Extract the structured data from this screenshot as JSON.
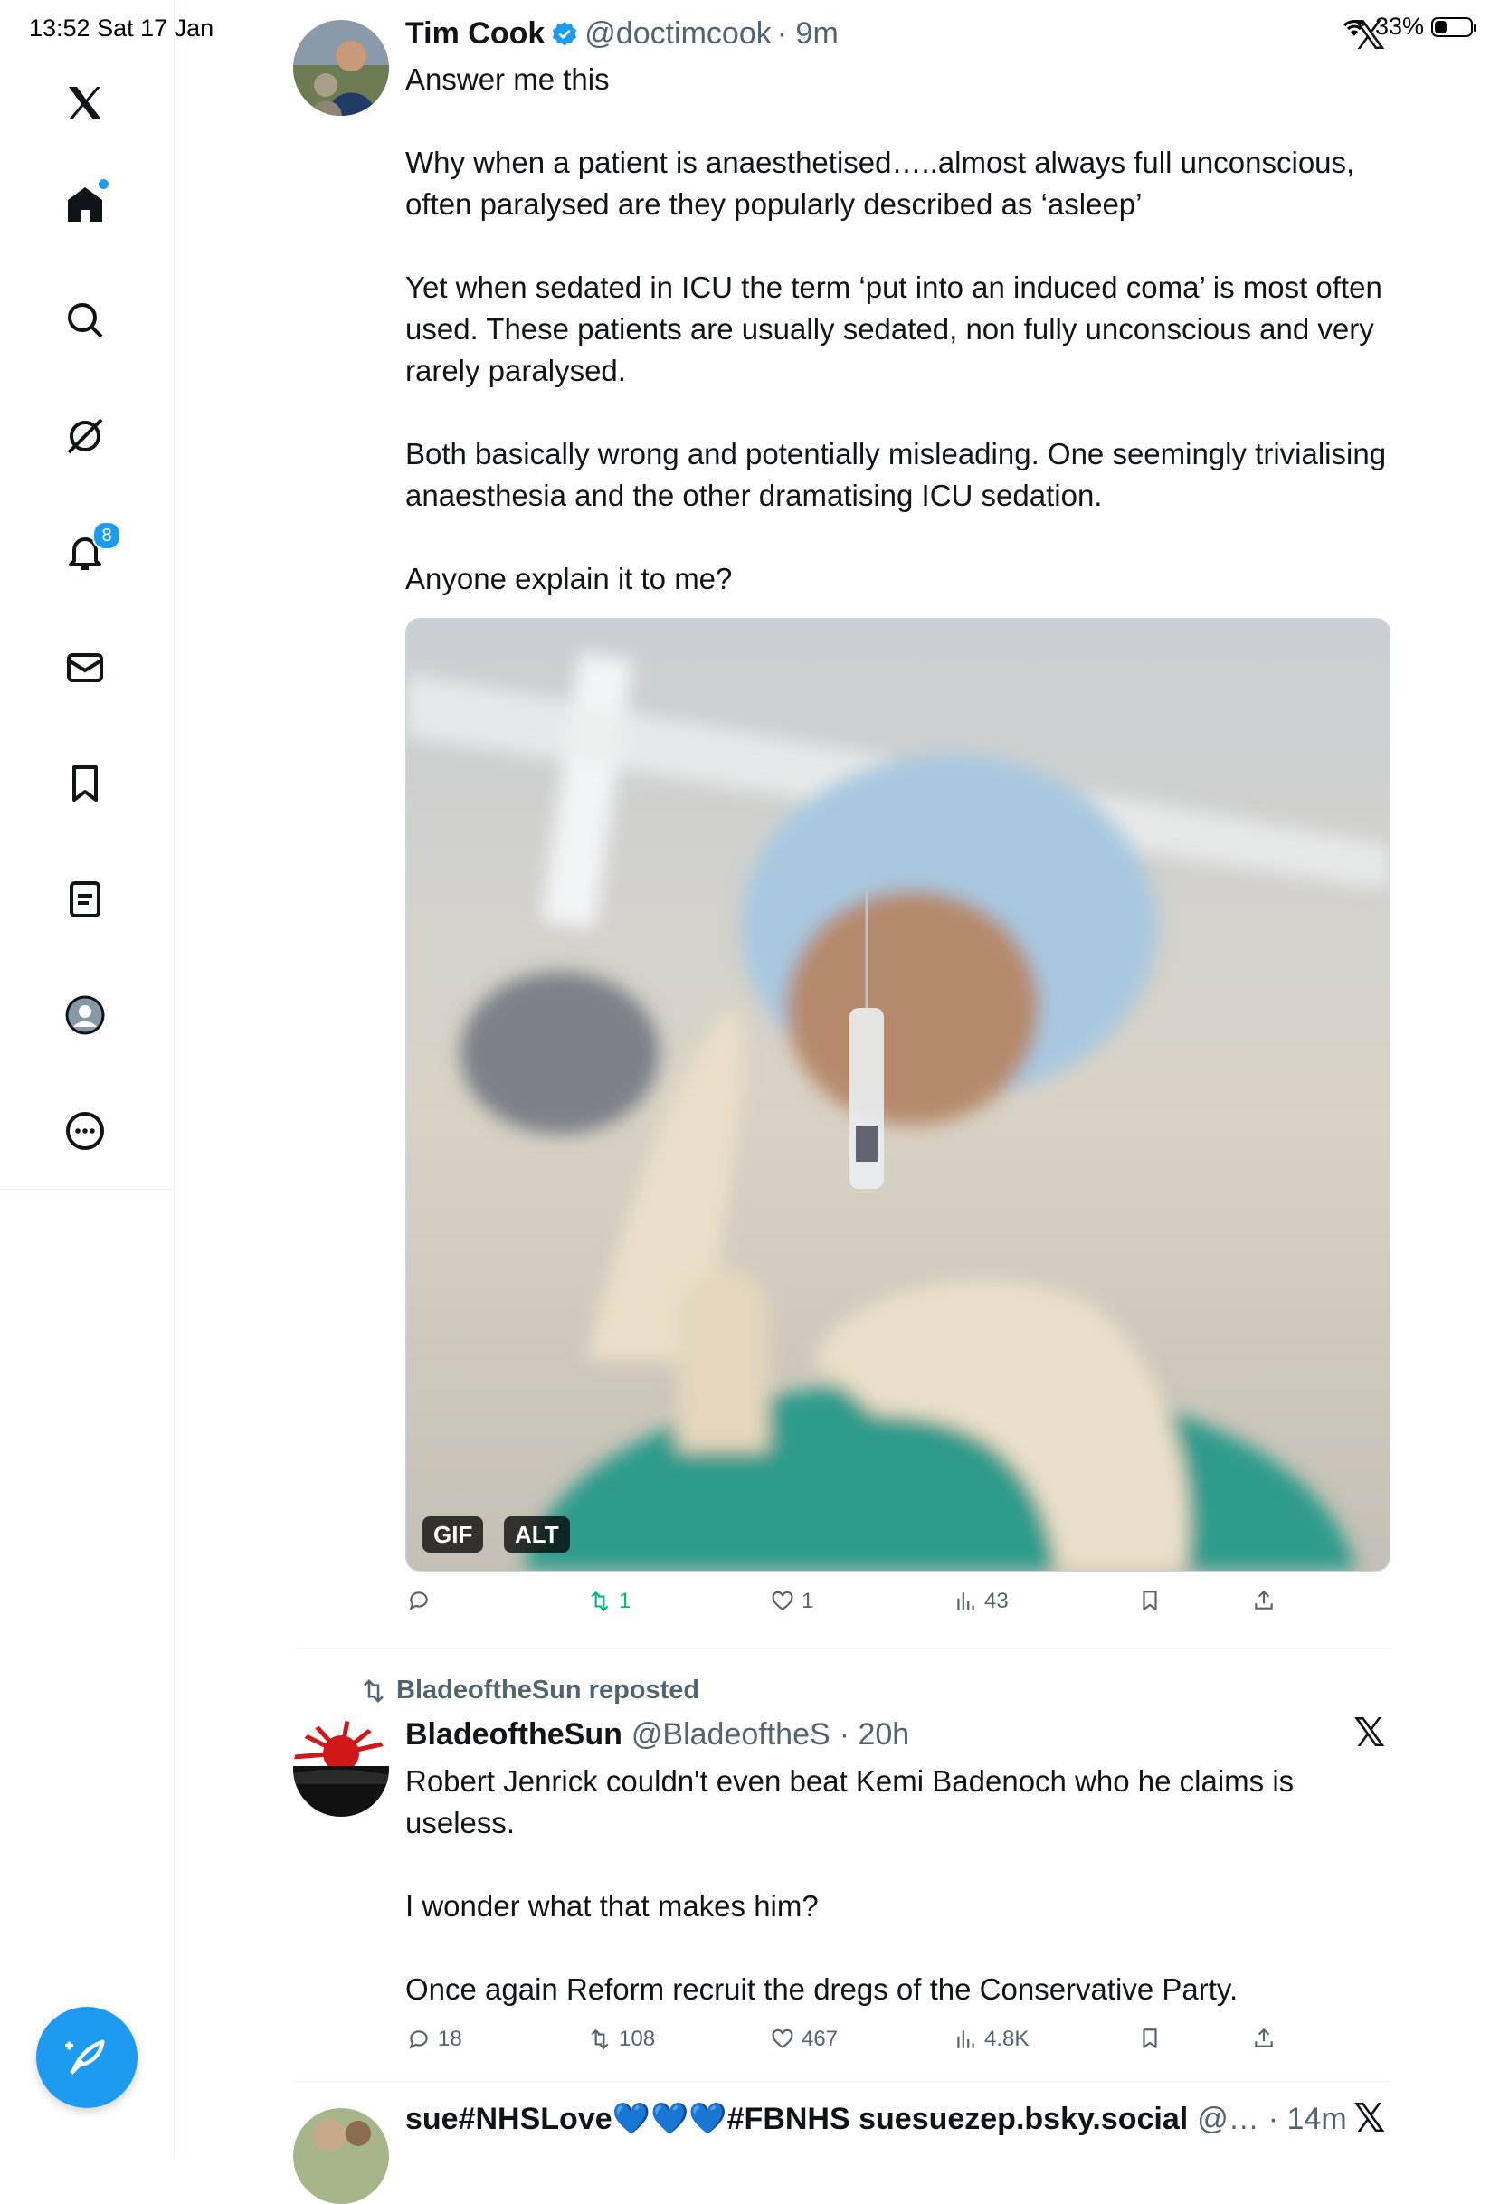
{
  "status_bar": {
    "time": "13:52  Sat 17 Jan",
    "battery": "33%",
    "battery_level": 0.33
  },
  "sidebar": {
    "items": [
      {
        "name": "x-logo"
      },
      {
        "name": "home"
      },
      {
        "name": "search"
      },
      {
        "name": "grok"
      },
      {
        "name": "notifications",
        "badge": "8"
      },
      {
        "name": "messages"
      },
      {
        "name": "bookmarks"
      },
      {
        "name": "lists"
      },
      {
        "name": "profile"
      },
      {
        "name": "more"
      }
    ]
  },
  "tweets": [
    {
      "name": "Tim Cook",
      "verified": true,
      "handle": "@doctimcook",
      "time": "· 9m",
      "text": "Answer me this\n\nWhy when a patient is anaesthetised…..almost always full unconscious, often paralysed are they popularly described as ‘asleep’\n\nYet when sedated in ICU the term ‘put into an induced coma’ is most often used. These patients are usually sedated, non fully unconscious and very rarely paralysed.\n\nBoth basically wrong and potentially misleading. One seemingly trivialising anaesthesia and the other dramatising ICU sedation.\n\nAnyone explain it to me?",
      "media_badges": [
        "GIF",
        "ALT"
      ],
      "actions": {
        "replies": "",
        "reposts": "1",
        "likes": "1",
        "views": "43"
      }
    },
    {
      "repost_label": "BladeoftheSun reposted",
      "name": "BladeoftheSun",
      "handle": "@BladeoftheS",
      "time": "· 20h",
      "text": "Robert Jenrick couldn't even beat Kemi Badenoch who he claims is useless.\n\nI wonder what that makes him?\n\nOnce again Reform recruit the dregs of the Conservative Party.",
      "actions": {
        "replies": "18",
        "reposts": "108",
        "likes": "467",
        "views": "4.8K"
      }
    },
    {
      "name": "sue#NHSLove💙💙💙#FBNHS suesuezep.bsky.social",
      "handle": "@…",
      "time": "· 14m"
    }
  ],
  "colors": {
    "accent": "#1d9bf0",
    "repost_green": "#00ba7c",
    "muted": "#536471"
  }
}
